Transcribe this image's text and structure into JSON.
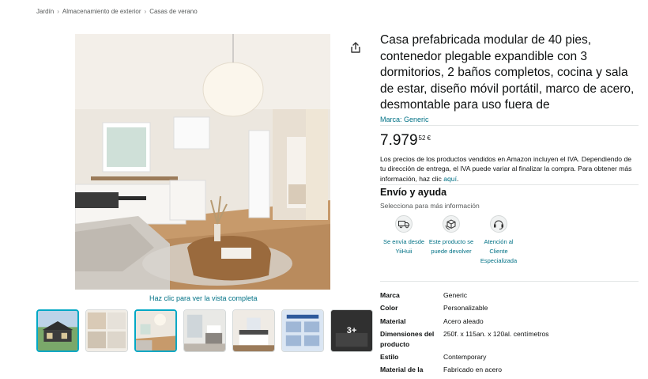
{
  "breadcrumb": [
    "Jardín",
    "Almacenamiento de exterior",
    "Casas de verano"
  ],
  "product": {
    "title": "Casa prefabricada modular de 40 pies, contenedor plegable expandible con 3 dormitorios, 2 baños completos, cocina y sala de estar, diseño móvil portátil, marco de acero, desmontable para uso fuera de",
    "brand_link": "Marca: Generic",
    "price_whole": "7.979",
    "price_fraction": "52",
    "price_currency": "€",
    "tax_note": "Los precios de los productos vendidos en Amazon incluyen el IVA. Dependiendo de tu dirección de entrega, el IVA puede variar al finalizar la compra. Para obtener más información, haz clic ",
    "tax_link": "aquí",
    "tax_end": "."
  },
  "gallery": {
    "zoom_label": "Haz clic para ver la vista completa",
    "more_label": "3+",
    "thumbs": [
      "exterior",
      "rooms",
      "living",
      "bathroom",
      "bedroom",
      "advantages",
      "more"
    ]
  },
  "shipping": {
    "title": "Envío y ayuda",
    "subtitle": "Selecciona para más información",
    "features": [
      {
        "icon": "truck-icon",
        "label": "Se envía desde YiiHuii"
      },
      {
        "icon": "return-box-icon",
        "label": "Este producto se puede devolver"
      },
      {
        "icon": "headset-icon",
        "label": "Atención al Cliente Especializada"
      }
    ]
  },
  "specs": [
    {
      "k": "Marca",
      "v": "Generic"
    },
    {
      "k": "Color",
      "v": "Personalizable"
    },
    {
      "k": "Material",
      "v": "Acero aleado"
    },
    {
      "k": "Dimensiones del producto",
      "v": "250f. x 115an. x 120al. centímetros"
    },
    {
      "k": "Estilo",
      "v": "Contemporary"
    },
    {
      "k": "Material de la",
      "v": "Fabricado en acero"
    }
  ],
  "colors": {
    "link": "#007185",
    "selected_border": "#00a8c5"
  }
}
